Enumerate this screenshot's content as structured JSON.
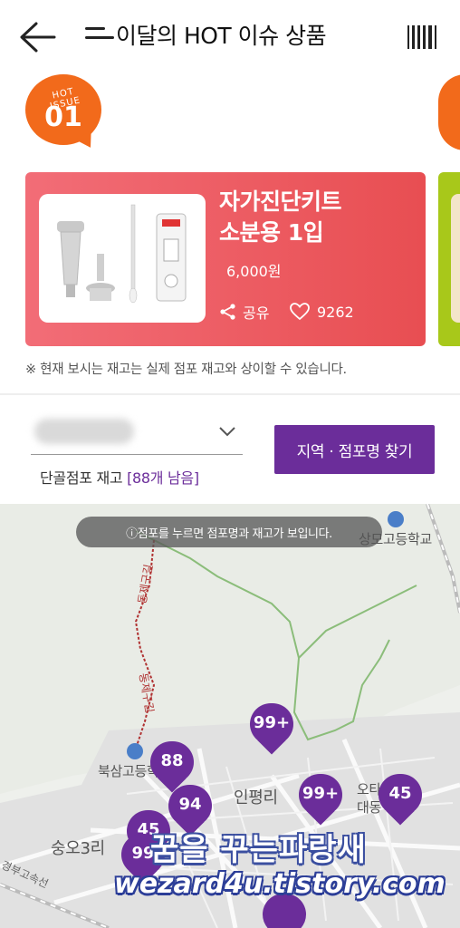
{
  "header": {
    "title": "이달의 HOT 이슈 상품",
    "back_icon": "back-arrow-icon",
    "menu_icon": "menu-icon",
    "barcode_icon": "barcode-icon"
  },
  "issue_badge": {
    "small_text": "HOT ISSUE",
    "number": "01"
  },
  "product": {
    "name_line1": "자가진단키트",
    "name_line2": "소분용 1입",
    "price": "6,000원",
    "share_label": "공유",
    "like_count": "9262"
  },
  "notice": "※ 현재 보시는 재고는 실제 점포 재고와 상이할 수 있습니다.",
  "store": {
    "stock_label": "단골점포 재고",
    "stock_count": "[88개 남음]",
    "find_button": "지역 · 점포명 찾기"
  },
  "map": {
    "tip": "ⓘ점포를 누르면 점포명과 재고가 보입니다.",
    "labels": {
      "school_top": "상모고등학교",
      "school_left": "북삼고등학",
      "village_1": "인평리",
      "village_2": "숭오3리",
      "village_3_line1": "오타",
      "village_3_line2": "대동",
      "road_1": "동제구길",
      "road_2": "동제구길",
      "highway": "경부고속선"
    },
    "pins": [
      "99+",
      "88",
      "94",
      "99+",
      "45",
      "45",
      "99"
    ]
  },
  "watermark": {
    "line1": "꿈을 꾸는파랑새",
    "line2": "wezard4u.tistory.com"
  },
  "colors": {
    "accent_purple": "#6b2d9a",
    "card_red": "#e84e52",
    "badge_orange": "#f26a1b"
  }
}
